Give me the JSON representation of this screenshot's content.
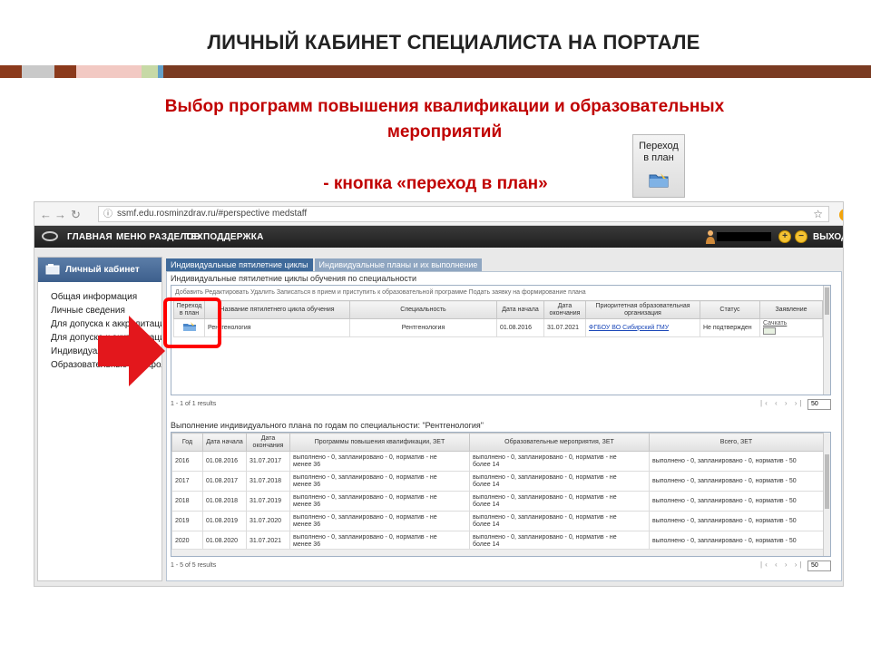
{
  "slide": {
    "title": "ЛИЧНЫЙ КАБИНЕТ СПЕЦИАЛИСТА НА ПОРТАЛЕ",
    "subtitle_line1": "Выбор программ повышения квалификации и образовательных",
    "subtitle_line2": "мероприятий",
    "subtitle_button": "- кнопка «переход в план»",
    "plan_button_label_1": "Переход",
    "plan_button_label_2": "в план",
    "stripe_colors": [
      "#8b3a1c",
      "#c9c9c9",
      "#8b3a1c",
      "#f2c9c3",
      "#c7d9a6",
      "#63a0c8",
      "#7a3b22"
    ]
  },
  "browser": {
    "url": "ssmf.edu.rosminzdrav.ru/#perspective medstaff",
    "menu": [
      "ГЛАВНАЯ",
      "МЕНЮ РАЗДЕЛОВ",
      "ТЕХПОДДЕРЖКА"
    ],
    "exit": "ВЫХОД"
  },
  "sidebar": {
    "header": "Личный кабинет",
    "items": [
      "Общая информация",
      "Личные сведения",
      "Для допуска к аккредитации",
      "Для допуска к аккредитации",
      "Индивидуальные планы",
      "Образовательные портфолио"
    ]
  },
  "tabs": [
    "Индивидуальные пятилетние циклы",
    "Индивидуальные планы и их выполнение"
  ],
  "cycles": {
    "title": "Индивидуальные пятилетние циклы обучения по специальности",
    "toolbar": "Добавить   Редактировать   Удалить     Записаться в прием и приступить к образовательной программе   Подать заявку на формирование плана",
    "columns": [
      "Переход в план",
      "Название пятилетнего цикла обучения",
      "Специальность",
      "Дата начала",
      "Дата окончания",
      "Приоритетная образовательная организация",
      "Статус",
      "Заявление"
    ],
    "rows": [
      {
        "name": "Рентгенология",
        "specialty": "Рентгенология",
        "start": "01.08.2016",
        "end": "31.07.2021",
        "org": "ФГБОУ ВО Сибирский ГМУ",
        "status": "Не подтвержден",
        "application": "Сачкать"
      }
    ],
    "pager_left": "1 - 1 of 1 results",
    "pager_arrows": "|‹ ‹ › ›|",
    "page_size": "50"
  },
  "plan": {
    "title": "Выполнение индивидуального плана по годам по специальности: \"Рентгенология\"",
    "columns": [
      "Год",
      "Дата начала",
      "Дата окончания",
      "Программы повышения квалификации, ЗЕТ",
      "Образовательные мероприятия, ЗЕТ",
      "Всего, ЗЕТ"
    ],
    "rows": [
      {
        "year": "2016",
        "start": "01.08.2016",
        "end": "31.07.2017",
        "programs_1": "выполнено - 0, запланировано - 0, норматив - не",
        "programs_2": "менее 36",
        "events_1": "выполнено - 0, запланировано - 0, норматив - не",
        "events_2": "более 14",
        "total": "выполнено - 0, запланировано - 0, норматив - 50"
      },
      {
        "year": "2017",
        "start": "01.08.2017",
        "end": "31.07.2018",
        "programs_1": "выполнено - 0, запланировано - 0, норматив - не",
        "programs_2": "менее 36",
        "events_1": "выполнено - 0, запланировано - 0, норматив - не",
        "events_2": "более 14",
        "total": "выполнено - 0, запланировано - 0, норматив - 50"
      },
      {
        "year": "2018",
        "start": "01.08.2018",
        "end": "31.07.2019",
        "programs_1": "выполнено - 0, запланировано - 0, норматив - не",
        "programs_2": "менее 36",
        "events_1": "выполнено - 0, запланировано - 0, норматив - не",
        "events_2": "более 14",
        "total": "выполнено - 0, запланировано - 0, норматив - 50"
      },
      {
        "year": "2019",
        "start": "01.08.2019",
        "end": "31.07.2020",
        "programs_1": "выполнено - 0, запланировано - 0, норматив - не",
        "programs_2": "менее 36",
        "events_1": "выполнено - 0, запланировано - 0, норматив - не",
        "events_2": "более 14",
        "total": "выполнено - 0, запланировано - 0, норматив - 50"
      },
      {
        "year": "2020",
        "start": "01.08.2020",
        "end": "31.07.2021",
        "programs_1": "выполнено - 0, запланировано - 0, норматив - не",
        "programs_2": "менее 36",
        "events_1": "выполнено - 0, запланировано - 0, норматив - не",
        "events_2": "более 14",
        "total": "выполнено - 0, запланировано - 0, норматив - 50"
      }
    ],
    "pager_left": "1 - 5 of 5 results",
    "pager_arrows": "|‹ ‹ › ›|",
    "page_size": "50"
  }
}
